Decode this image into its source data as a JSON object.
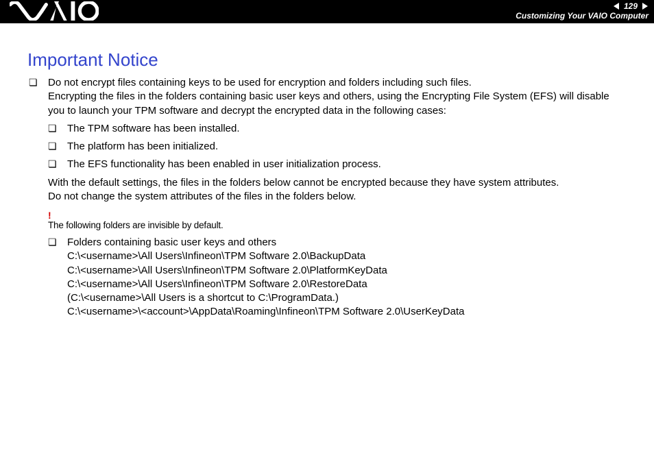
{
  "header": {
    "page_number": "129",
    "section": "Customizing Your VAIO Computer"
  },
  "content": {
    "title": "Important Notice",
    "bullet1_line1": "Do not encrypt files containing keys to be used for encryption and folders including such files.",
    "bullet1_line2": "Encrypting the files in the folders containing basic user keys and others, using the Encrypting File System (EFS) will disable you to launch your TPM software and decrypt the encrypted data in the following cases:",
    "sub1": "The TPM software has been installed.",
    "sub2": "The platform has been initialized.",
    "sub3": "The EFS functionality has been enabled in user initialization process.",
    "para1": "With the default settings, the files in the folders below cannot be encrypted because they have system attributes.",
    "para2": "Do not change the system attributes of the files in the folders below.",
    "warn_mark": "!",
    "warn_text": "The following folders are invisible by default.",
    "folders_intro": "Folders containing basic user keys and others",
    "path1": "C:\\<username>\\All Users\\Infineon\\TPM Software 2.0\\BackupData",
    "path2": "C:\\<username>\\All Users\\Infineon\\TPM Software 2.0\\PlatformKeyData",
    "path3": "C:\\<username>\\All Users\\Infineon\\TPM Software 2.0\\RestoreData",
    "path4": "(C:\\<username>\\All Users is a shortcut to C:\\ProgramData.)",
    "path5": "C:\\<username>\\<account>\\AppData\\Roaming\\Infineon\\TPM Software 2.0\\UserKeyData"
  }
}
